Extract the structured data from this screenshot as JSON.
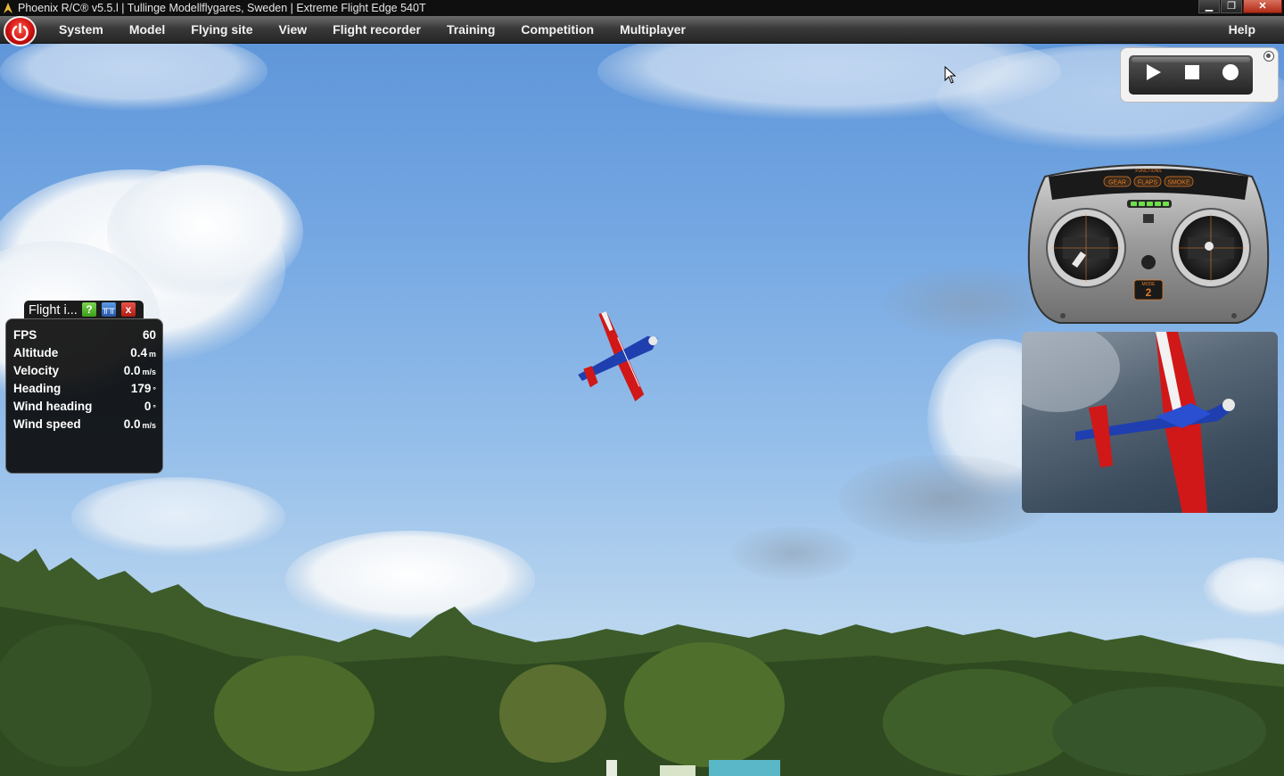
{
  "window": {
    "title": "Phoenix R/C® v5.5.l  |  Tullinge Modellflygares, Sweden  |  Extreme Flight Edge 540T",
    "controls": [
      "minimize-icon",
      "restore-icon",
      "close-icon"
    ]
  },
  "menu": {
    "items": [
      "System",
      "Model",
      "Flying site",
      "View",
      "Flight recorder",
      "Training",
      "Competition",
      "Multiplayer"
    ],
    "help": "Help"
  },
  "recorder": {
    "buttons": [
      "play-icon",
      "stop-icon",
      "record-icon"
    ]
  },
  "transmitter": {
    "header": "FUNCTIONS",
    "switches": [
      "GEAR",
      "FLAPS",
      "SMOKE"
    ],
    "mode_label": "MODE",
    "mode": "2"
  },
  "flight_info": {
    "title": "Flight i...",
    "rows": [
      {
        "label": "FPS",
        "value": "60",
        "unit": ""
      },
      {
        "label": "Altitude",
        "value": "0.4",
        "unit": "m"
      },
      {
        "label": "Velocity",
        "value": "0.0",
        "unit": "m/s"
      },
      {
        "label": "Heading",
        "value": "179",
        "unit": "°"
      },
      {
        "label": "Wind heading",
        "value": "0",
        "unit": "°"
      },
      {
        "label": "Wind speed",
        "value": "0.0",
        "unit": "m/s"
      }
    ]
  },
  "colors": {
    "power_button": "#d01010",
    "plane_red": "#d01818",
    "plane_blue": "#1f3fb0",
    "help_green": "#4caf22",
    "close_red": "#d02a20"
  }
}
